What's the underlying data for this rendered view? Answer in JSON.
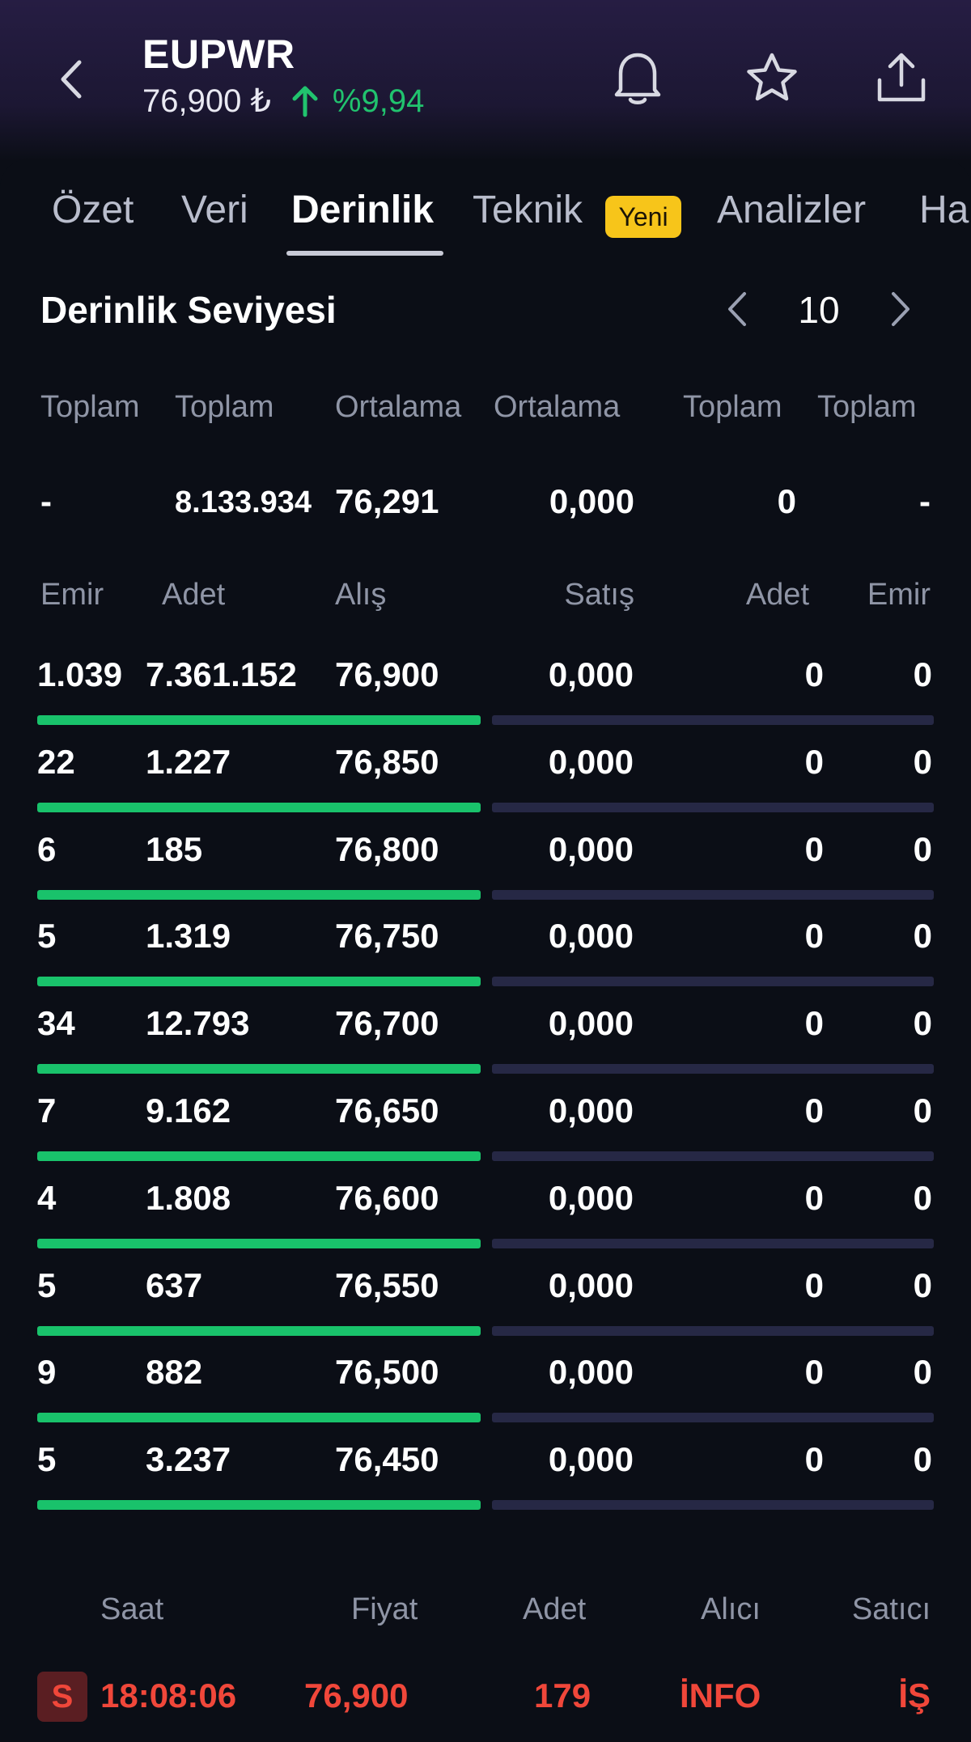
{
  "header": {
    "ticker": "EUPWR",
    "price": "76,900 ₺",
    "change": "%9,94",
    "colors": {
      "up": "#21c36e"
    },
    "icons": {
      "back": "chevron-left-icon",
      "alert": "bell-icon",
      "favorite": "star-icon",
      "share": "share-icon"
    }
  },
  "tabs": [
    {
      "label": "Özet"
    },
    {
      "label": "Veri"
    },
    {
      "label": "Derinlik",
      "active": true
    },
    {
      "label": "Teknik",
      "badge": "Yeni"
    },
    {
      "label": "Analizler"
    },
    {
      "label": "Ha"
    }
  ],
  "depth": {
    "title": "Derinlik Seviyesi",
    "level": "10",
    "summary_headers": [
      "Toplam",
      "Toplam",
      "Ortalama",
      "Ortalama",
      "Toplam",
      "Toplam"
    ],
    "summary_values": [
      "-",
      "8.133.934",
      "76,291",
      "0,000",
      "0",
      "-"
    ],
    "columns": [
      "Emir",
      "Adet",
      "Alış",
      "Satış",
      "Adet",
      "Emir"
    ],
    "rows": [
      {
        "bid_orders": "1.039",
        "bid_qty": "7.361.152",
        "bid_price": "76,900",
        "ask_price": "0,000",
        "ask_qty": "0",
        "ask_orders": "0",
        "bid_fill": 1.0,
        "ask_fill": 0
      },
      {
        "bid_orders": "22",
        "bid_qty": "1.227",
        "bid_price": "76,850",
        "ask_price": "0,000",
        "ask_qty": "0",
        "ask_orders": "0",
        "bid_fill": 1.0,
        "ask_fill": 0
      },
      {
        "bid_orders": "6",
        "bid_qty": "185",
        "bid_price": "76,800",
        "ask_price": "0,000",
        "ask_qty": "0",
        "ask_orders": "0",
        "bid_fill": 1.0,
        "ask_fill": 0
      },
      {
        "bid_orders": "5",
        "bid_qty": "1.319",
        "bid_price": "76,750",
        "ask_price": "0,000",
        "ask_qty": "0",
        "ask_orders": "0",
        "bid_fill": 1.0,
        "ask_fill": 0
      },
      {
        "bid_orders": "34",
        "bid_qty": "12.793",
        "bid_price": "76,700",
        "ask_price": "0,000",
        "ask_qty": "0",
        "ask_orders": "0",
        "bid_fill": 1.0,
        "ask_fill": 0
      },
      {
        "bid_orders": "7",
        "bid_qty": "9.162",
        "bid_price": "76,650",
        "ask_price": "0,000",
        "ask_qty": "0",
        "ask_orders": "0",
        "bid_fill": 1.0,
        "ask_fill": 0
      },
      {
        "bid_orders": "4",
        "bid_qty": "1.808",
        "bid_price": "76,600",
        "ask_price": "0,000",
        "ask_qty": "0",
        "ask_orders": "0",
        "bid_fill": 1.0,
        "ask_fill": 0
      },
      {
        "bid_orders": "5",
        "bid_qty": "637",
        "bid_price": "76,550",
        "ask_price": "0,000",
        "ask_qty": "0",
        "ask_orders": "0",
        "bid_fill": 1.0,
        "ask_fill": 0
      },
      {
        "bid_orders": "9",
        "bid_qty": "882",
        "bid_price": "76,500",
        "ask_price": "0,000",
        "ask_qty": "0",
        "ask_orders": "0",
        "bid_fill": 1.0,
        "ask_fill": 0
      },
      {
        "bid_orders": "5",
        "bid_qty": "3.237",
        "bid_price": "76,450",
        "ask_price": "0,000",
        "ask_qty": "0",
        "ask_orders": "0",
        "bid_fill": 1.0,
        "ask_fill": 0
      }
    ]
  },
  "trades": {
    "columns": [
      "Saat",
      "Fiyat",
      "Adet",
      "Alıcı",
      "Satıcı"
    ],
    "rows": [
      {
        "side": "S",
        "time": "18:08:06",
        "price": "76,900",
        "qty": "179",
        "buyer": "İNFO",
        "seller": "İŞ"
      }
    ],
    "colors": {
      "sell": "#f0473a"
    }
  }
}
